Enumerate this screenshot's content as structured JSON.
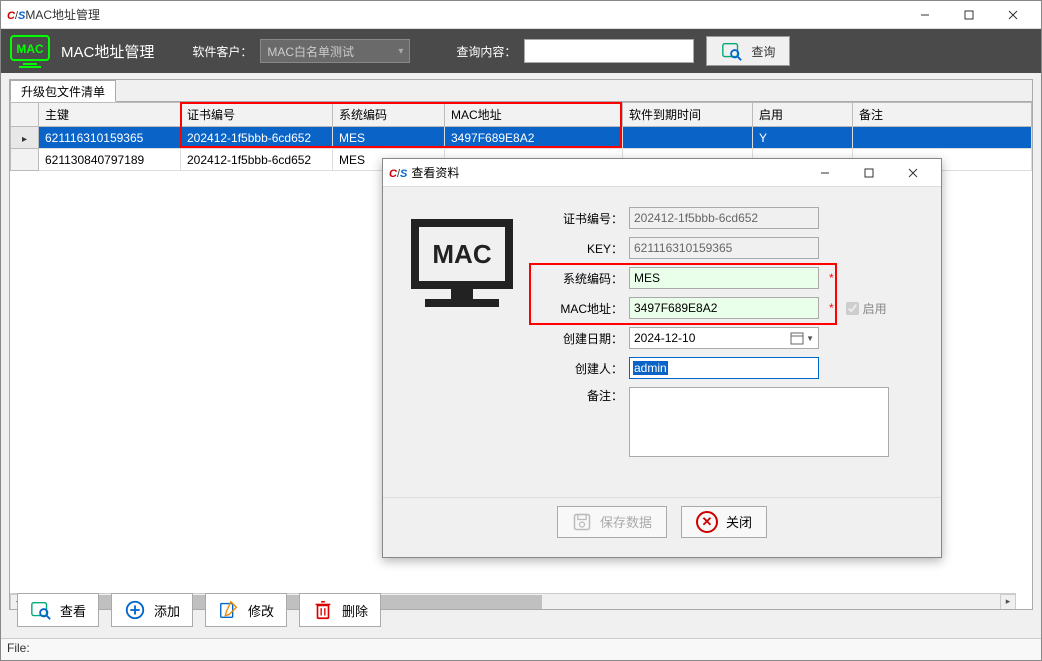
{
  "main_window": {
    "title": "MAC地址管理",
    "toolbar": {
      "page_title": "MAC地址管理",
      "client_label": "软件客户：",
      "client_value": "MAC白名单测试",
      "search_label": "查询内容：",
      "search_value": "",
      "query_button": "查询"
    },
    "tab_label": "升级包文件清单",
    "columns": {
      "key": "主键",
      "cert_no": "证书编号",
      "sys_code": "系统编码",
      "mac_addr": "MAC地址",
      "expire": "软件到期时间",
      "enabled": "启用",
      "remark": "备注"
    },
    "rows": [
      {
        "key": "621116310159365",
        "cert_no": "202412-1f5bbb-6cd652",
        "sys_code": "MES",
        "mac_addr": "3497F689E8A2",
        "expire": "",
        "enabled": "Y",
        "remark": "",
        "selected": true
      },
      {
        "key": "621130840797189",
        "cert_no": "202412-1f5bbb-6cd652",
        "sys_code": "MES",
        "mac_addr": "",
        "expire": "",
        "enabled": "",
        "remark": "",
        "selected": false
      }
    ],
    "actions": {
      "view": "查看",
      "add": "添加",
      "edit": "修改",
      "delete": "删除"
    },
    "statusbar": "File:"
  },
  "dialog": {
    "title": "查看资料",
    "icon_text": "MAC",
    "fields": {
      "cert_no_label": "证书编号：",
      "cert_no_value": "202412-1f5bbb-6cd652",
      "key_label": "KEY：",
      "key_value": "621116310159365",
      "sys_code_label": "系统编码：",
      "sys_code_value": "MES",
      "mac_label": "MAC地址：",
      "mac_value": "3497F689E8A2",
      "enabled_label": "启用",
      "create_date_label": "创建日期：",
      "create_date_value": "2024-12-10",
      "creator_label": "创建人：",
      "creator_value": "admin",
      "remark_label": "备注：",
      "remark_value": ""
    },
    "buttons": {
      "save": "保存数据",
      "close": "关闭"
    }
  }
}
